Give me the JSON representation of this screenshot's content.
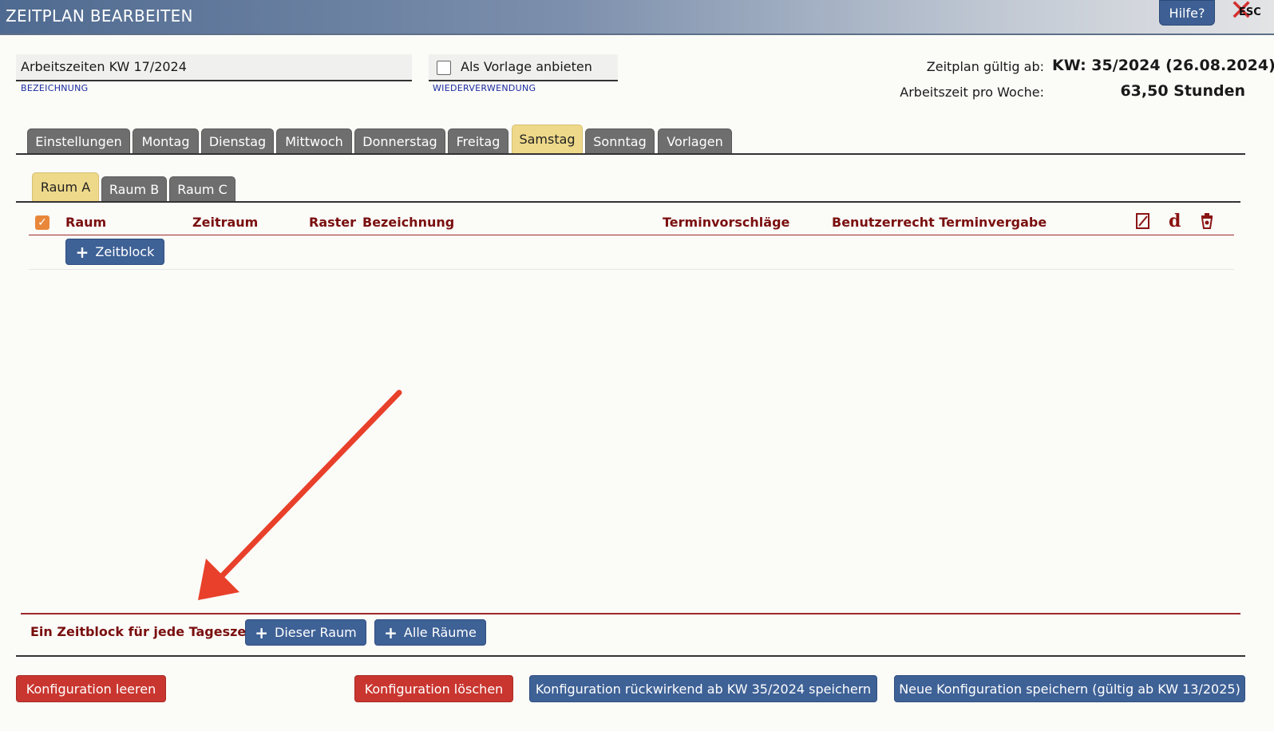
{
  "window": {
    "title": "ZEITPLAN BEARBEITEN",
    "help_label": "Hilfe?",
    "esc_label": "ESC"
  },
  "form": {
    "name_value": "Arbeitszeiten KW 17/2024",
    "name_caption": "BEZEICHNUNG",
    "template_label": "Als Vorlage anbieten",
    "template_checked": false,
    "template_caption": "WIEDERVERWENDUNG"
  },
  "info": {
    "valid_label": "Zeitplan gültig ab:",
    "valid_value": "KW: 35/2024 (26.08.2024)",
    "hours_label": "Arbeitszeit pro Woche:",
    "hours_value": "63,50 Stunden"
  },
  "day_tabs": [
    {
      "label": "Einstellungen"
    },
    {
      "label": "Montag"
    },
    {
      "label": "Dienstag"
    },
    {
      "label": "Mittwoch"
    },
    {
      "label": "Donnerstag"
    },
    {
      "label": "Freitag"
    },
    {
      "label": "Samstag",
      "active": true
    },
    {
      "label": "Sonntag"
    },
    {
      "label": "Vorlagen"
    }
  ],
  "room_tabs": [
    {
      "label": "Raum A",
      "active": true
    },
    {
      "label": "Raum B"
    },
    {
      "label": "Raum C"
    }
  ],
  "table": {
    "columns": {
      "raum": "Raum",
      "zeitraum": "Zeitraum",
      "raster": "Raster",
      "bezeichnung": "Bezeichnung",
      "terminvorschlaege": "Terminvorschläge",
      "benutzerrecht": "Benutzerrecht Terminvergabe"
    },
    "header_icons": [
      "edit-icon",
      "d-icon",
      "trash-icon"
    ],
    "add_block_label": "Zeitblock"
  },
  "footer": {
    "every_label": "Ein Zeitblock für jede Tageszeit:",
    "this_room_label": "Dieser Raum",
    "all_rooms_label": "Alle Räume",
    "clear_label": "Konfiguration leeren",
    "delete_label": "Konfiguration löschen",
    "save_retro_label": "Konfiguration rückwirkend ab KW 35/2024 speichern",
    "save_new_label": "Neue Konfiguration speichern (gültig ab KW 13/2025)"
  },
  "colors": {
    "accent_blue": "#3e6196",
    "danger_red": "#c9362f",
    "active_tab": "#eed98a",
    "header_text": "#7a0f0f",
    "annotation_arrow": "#e8402a"
  }
}
